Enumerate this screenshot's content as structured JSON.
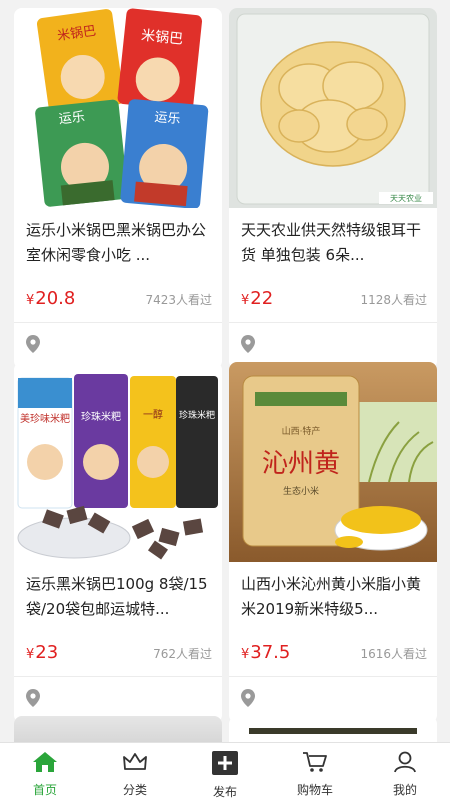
{
  "products": [
    {
      "title": "运乐小米锅巴黑米锅巴办公室休闲零食小吃 ...",
      "currency": "¥",
      "price": "20.8",
      "views": "7423人看过"
    },
    {
      "title": "天天农业供天然特级银耳干货 单独包装 6朵...",
      "currency": "¥",
      "price": "22",
      "views": "1128人看过"
    },
    {
      "title": "运乐黑米锅巴100g 8袋/15袋/20袋包邮运城特...",
      "currency": "¥",
      "price": "23",
      "views": "762人看过"
    },
    {
      "title": "山西小米沁州黄小米脂小黄米2019新米特级5...",
      "currency": "¥",
      "price": "37.5",
      "views": "1616人看过"
    }
  ],
  "package_text": {
    "bag1": "米锅巴",
    "bag2": "米锅巴",
    "brand1": "运乐",
    "brand2": "运乐",
    "bag3": "美珍味米粑",
    "bag4": "珍珠米粑",
    "bag5": "一醇",
    "bag6": "珍珠米粑",
    "rice_big": "沁州黄",
    "rice_origin": "山西·特产",
    "rice_sub": "生态小米",
    "fungus_label": "天天农业"
  },
  "tabs": [
    {
      "label": "首页",
      "icon": "home-icon",
      "active": true
    },
    {
      "label": "分类",
      "icon": "crown-icon",
      "active": false
    },
    {
      "label": "发布",
      "icon": "plus-icon",
      "active": false
    },
    {
      "label": "购物车",
      "icon": "cart-icon",
      "active": false
    },
    {
      "label": "我的",
      "icon": "user-icon",
      "active": false
    }
  ],
  "colors": {
    "accent": "#2aa53a",
    "price": "#e02020"
  }
}
